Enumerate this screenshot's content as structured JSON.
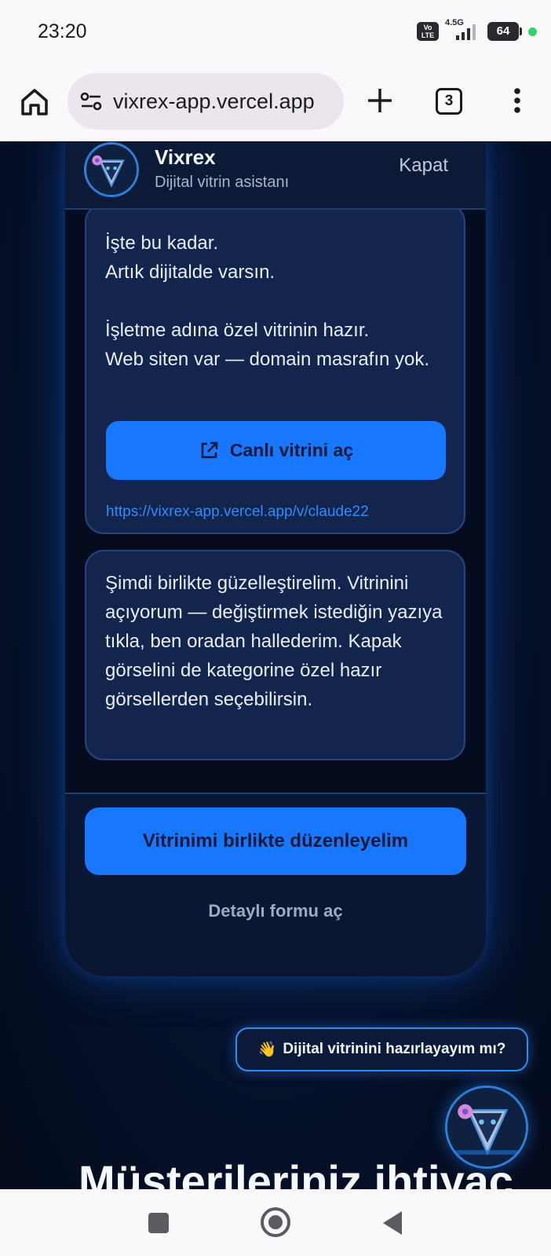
{
  "status_bar": {
    "time": "23:20",
    "volte_label": "Vo LTE",
    "network": "4.5G",
    "battery": "64"
  },
  "browser": {
    "url": "vixrex-app.vercel.app",
    "tab_count": "3"
  },
  "chat": {
    "assistant_name": "Vixrex",
    "assistant_subtitle": "Dijital vitrin asistanı",
    "close_label": "Kapat",
    "messages": [
      {
        "text": "İşte bu kadar.\nArtık dijitalde varsın.\n\nİşletme adına özel vitrinin hazır.\nWeb siten var — domain masrafın yok.",
        "button_label": "Canlı vitrini aç",
        "link": "https://vixrex-app.vercel.app/v/claude22"
      },
      {
        "text": "Şimdi birlikte güzelleştirelim. Vitrinini açıyorum — değiştirmek istediğin yazıya tıkla, ben oradan hallederim. Kapak görselini de kategorine özel hazır görsellerden seçebilirsin."
      }
    ],
    "primary_button": "Vitrinimi birlikte düzenleyelim",
    "secondary_link": "Detaylı formu aç"
  },
  "prompt_chip": {
    "emoji": "👋",
    "label": "Dijital vitrinini hazırlayayım mı?"
  },
  "hero": {
    "heading": "Müşterileriniz ihtiyaç"
  },
  "colors": {
    "accent": "#1778ff",
    "panel": "#0a1732",
    "bubble": "#13254d"
  }
}
